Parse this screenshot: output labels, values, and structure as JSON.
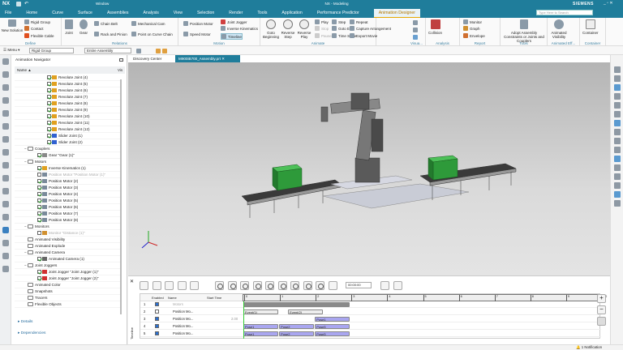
{
  "app": {
    "logo": "NX",
    "window_menu": "Window",
    "title": "NX - Modeling",
    "brand": "SIEMENS",
    "search_placeholder": "Type Here to Search"
  },
  "menu_tabs": [
    "File",
    "Home",
    "Curve",
    "Surface",
    "Assemblies",
    "Analysis",
    "View",
    "Selection",
    "Render",
    "Tools",
    "Application",
    "Performance Predictor",
    "Animation Designer"
  ],
  "active_tab": "Animation Designer",
  "ribbon": {
    "define": {
      "label": "Define",
      "new_solution": "New Solution",
      "items": [
        "Rigid Group",
        "Contact",
        "Flexible Cable"
      ]
    },
    "relations": {
      "label": "Relations",
      "items": [
        "Joint",
        "Gear",
        "Chain Belt",
        "Rack and Pinion",
        "Mechanical Cam",
        "Point on Curve Chain"
      ]
    },
    "motion": {
      "label": "Motion",
      "items": [
        "Position Motor",
        "Speed Motor",
        "Joint Jogger",
        "Inverse Kinematics",
        "Timeline"
      ]
    },
    "animate": {
      "label": "Animate",
      "big": [
        "Goto Beginning",
        "Reverse Step",
        "Reverse Play"
      ],
      "items": [
        "Play",
        "Stop",
        "Pause",
        "Step",
        "Goto End",
        "Time Scale",
        "Repeat",
        "Capture Arrangement",
        "Export Movie"
      ]
    },
    "visual": {
      "label": "Visua..."
    },
    "analysis": {
      "label": "Analysis",
      "items": [
        "Collision"
      ]
    },
    "report": {
      "label": "Report",
      "items": [
        "Monitor",
        "Graph",
        "Envelope"
      ]
    },
    "tools": {
      "label": "Tools",
      "items": [
        "Adopt Assembly Constraints or Joints and Couplers"
      ]
    },
    "animated_eff": {
      "label": "Animated Eff...",
      "items": [
        "Animated Visibility"
      ]
    },
    "container": {
      "label": "Container",
      "items": [
        "Container"
      ]
    }
  },
  "toolbar": {
    "menu": "Menu",
    "filter": "Rigid Group",
    "scope": "Entire Assembly"
  },
  "navigator": {
    "title": "Animation Navigator",
    "col_name": "Name",
    "col_vis": "Vis",
    "items": [
      {
        "label": "Revolute Joint (4)",
        "level": 3,
        "type": "revolute",
        "checked": true
      },
      {
        "label": "Revolute Joint (5)",
        "level": 3,
        "type": "revolute",
        "checked": true
      },
      {
        "label": "Revolute Joint (6)",
        "level": 3,
        "type": "revolute",
        "checked": true
      },
      {
        "label": "Revolute Joint (7)",
        "level": 3,
        "type": "revolute",
        "checked": true
      },
      {
        "label": "Revolute Joint (8)",
        "level": 3,
        "type": "revolute",
        "checked": true
      },
      {
        "label": "Revolute Joint (9)",
        "level": 3,
        "type": "revolute",
        "checked": true
      },
      {
        "label": "Revolute Joint (10)",
        "level": 3,
        "type": "revolute",
        "checked": true
      },
      {
        "label": "Revolute Joint (11)",
        "level": 3,
        "type": "revolute",
        "checked": true
      },
      {
        "label": "Revolute Joint (12)",
        "level": 3,
        "type": "revolute",
        "checked": true
      },
      {
        "label": "Slider Joint (1)",
        "level": 3,
        "type": "slider",
        "checked": true
      },
      {
        "label": "Slider Joint (2)",
        "level": 3,
        "type": "slider",
        "checked": true
      },
      {
        "label": "Couplers",
        "level": 1,
        "type": "folder",
        "expanded": true
      },
      {
        "label": "Gear \"Gear (1)\"",
        "level": 2,
        "type": "gear",
        "checked": true
      },
      {
        "label": "Motors",
        "level": 1,
        "type": "folder",
        "expanded": true
      },
      {
        "label": "Inverse Kinematics (1)",
        "level": 2,
        "type": "ik",
        "checked": true
      },
      {
        "label": "Position Motor \"Position Motor (1)\"",
        "level": 2,
        "type": "motor",
        "checked": false,
        "dim": true
      },
      {
        "label": "Position Motor (2)",
        "level": 2,
        "type": "motor",
        "checked": true
      },
      {
        "label": "Position Motor (3)",
        "level": 2,
        "type": "motor",
        "checked": true
      },
      {
        "label": "Position Motor (4)",
        "level": 2,
        "type": "motor",
        "checked": true
      },
      {
        "label": "Position Motor (5)",
        "level": 2,
        "type": "motor",
        "checked": true
      },
      {
        "label": "Position Motor (6)",
        "level": 2,
        "type": "motor",
        "checked": true
      },
      {
        "label": "Position Motor (7)",
        "level": 2,
        "type": "motor",
        "checked": true
      },
      {
        "label": "Position Motor (8)",
        "level": 2,
        "type": "motor",
        "checked": true
      },
      {
        "label": "Monitors",
        "level": 1,
        "type": "folder",
        "expanded": true
      },
      {
        "label": "Monitor \"Distance (1)\"",
        "level": 2,
        "type": "monitor",
        "checked": false,
        "dim": true
      },
      {
        "label": "Animated Visibility",
        "level": 1,
        "type": "folder"
      },
      {
        "label": "Animated Explode",
        "level": 1,
        "type": "folder"
      },
      {
        "label": "Animated Camera",
        "level": 1,
        "type": "folder",
        "expanded": true
      },
      {
        "label": "Animated Camera (1)",
        "level": 2,
        "type": "camera",
        "checked": true
      },
      {
        "label": "Joint Joggers",
        "level": 1,
        "type": "folder",
        "expanded": true
      },
      {
        "label": "Joint Jogger \"Joint Jogger (1)\"",
        "level": 2,
        "type": "jogger",
        "checked": true
      },
      {
        "label": "Joint Jogger \"Joint Jogger (2)\"",
        "level": 2,
        "type": "jogger",
        "checked": true
      },
      {
        "label": "Animated Color",
        "level": 1,
        "type": "folder"
      },
      {
        "label": "Snapshots",
        "level": 1,
        "type": "folder"
      },
      {
        "label": "Tracers",
        "level": 1,
        "type": "folder"
      },
      {
        "label": "Flexible Objects",
        "level": 1,
        "type": "folder"
      }
    ],
    "details": "Details",
    "dependencies": "Dependencies"
  },
  "doc_tabs": {
    "discovery": "Discovery Center",
    "active": "M900iB700_Assembly.prt"
  },
  "timeline": {
    "label": "Timeline",
    "time": "00:00:00",
    "columns": [
      "Enabled",
      "Name",
      "Start Time"
    ],
    "ruler": [
      "0",
      "1",
      "2",
      "3",
      "4",
      "5",
      "6",
      "7",
      "8",
      "9",
      "10"
    ],
    "rows": [
      {
        "num": "1",
        "enabled": true,
        "name": "Motors",
        "start": "",
        "bars": [
          {
            "s": 0,
            "e": 3,
            "label": "",
            "kind": "group"
          }
        ]
      },
      {
        "num": "2",
        "enabled": false,
        "name": "Position Mo...",
        "start": "",
        "bars": [
          {
            "s": 0,
            "e": 1,
            "label": "Event(1)",
            "kind": "event"
          },
          {
            "s": 1.25,
            "e": 2.25,
            "label": "Event(2)",
            "kind": "event"
          }
        ]
      },
      {
        "num": "3",
        "enabled": true,
        "name": "Position Mo...",
        "start": "2.00",
        "bars": [
          {
            "s": 2,
            "e": 3,
            "label": "Pose1",
            "kind": "pose"
          }
        ]
      },
      {
        "num": "4",
        "enabled": true,
        "name": "Position Mo...",
        "start": "",
        "bars": [
          {
            "s": 0,
            "e": 1,
            "label": "Pose1",
            "kind": "pose"
          },
          {
            "s": 1,
            "e": 2,
            "label": "Pose2",
            "kind": "pose"
          },
          {
            "s": 2,
            "e": 3,
            "label": "Pose3",
            "kind": "pose"
          }
        ]
      },
      {
        "num": "5",
        "enabled": true,
        "name": "Position Mo...",
        "start": "",
        "bars": [
          {
            "s": 0,
            "e": 1,
            "label": "Pose1",
            "kind": "pose"
          },
          {
            "s": 1,
            "e": 2,
            "label": "Pose2",
            "kind": "pose"
          },
          {
            "s": 2,
            "e": 3,
            "label": "Pose3",
            "kind": "pose"
          }
        ]
      }
    ]
  },
  "status": {
    "notification": "1 Notification"
  },
  "colors": {
    "titlebar": "#1f7d9b",
    "active_tab": "#b77800",
    "pose_bar": "#a9a6f0",
    "event_bar": "#eeeeee",
    "group_bar": "#8a8a8a",
    "bin": "#2e9a3a"
  }
}
